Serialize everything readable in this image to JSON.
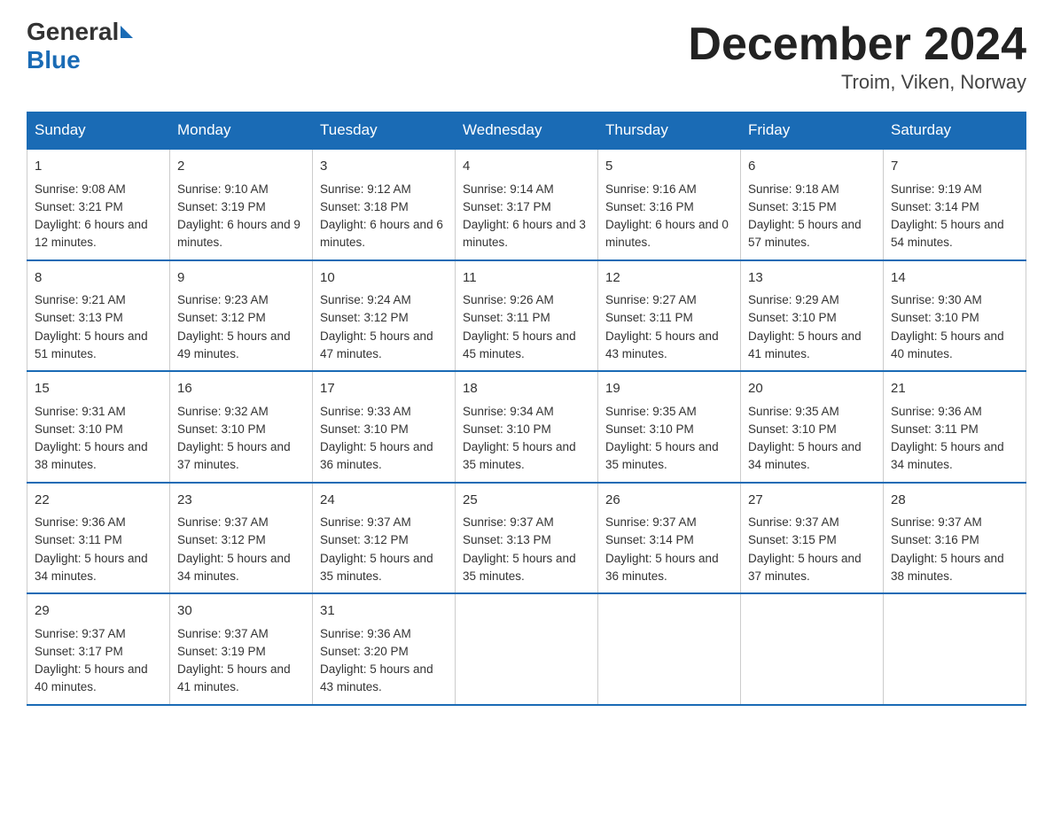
{
  "header": {
    "logo_general": "General",
    "logo_blue": "Blue",
    "month_title": "December 2024",
    "location": "Troim, Viken, Norway"
  },
  "days_of_week": [
    "Sunday",
    "Monday",
    "Tuesday",
    "Wednesday",
    "Thursday",
    "Friday",
    "Saturday"
  ],
  "weeks": [
    [
      {
        "day": "1",
        "sunrise": "Sunrise: 9:08 AM",
        "sunset": "Sunset: 3:21 PM",
        "daylight": "Daylight: 6 hours and 12 minutes."
      },
      {
        "day": "2",
        "sunrise": "Sunrise: 9:10 AM",
        "sunset": "Sunset: 3:19 PM",
        "daylight": "Daylight: 6 hours and 9 minutes."
      },
      {
        "day": "3",
        "sunrise": "Sunrise: 9:12 AM",
        "sunset": "Sunset: 3:18 PM",
        "daylight": "Daylight: 6 hours and 6 minutes."
      },
      {
        "day": "4",
        "sunrise": "Sunrise: 9:14 AM",
        "sunset": "Sunset: 3:17 PM",
        "daylight": "Daylight: 6 hours and 3 minutes."
      },
      {
        "day": "5",
        "sunrise": "Sunrise: 9:16 AM",
        "sunset": "Sunset: 3:16 PM",
        "daylight": "Daylight: 6 hours and 0 minutes."
      },
      {
        "day": "6",
        "sunrise": "Sunrise: 9:18 AM",
        "sunset": "Sunset: 3:15 PM",
        "daylight": "Daylight: 5 hours and 57 minutes."
      },
      {
        "day": "7",
        "sunrise": "Sunrise: 9:19 AM",
        "sunset": "Sunset: 3:14 PM",
        "daylight": "Daylight: 5 hours and 54 minutes."
      }
    ],
    [
      {
        "day": "8",
        "sunrise": "Sunrise: 9:21 AM",
        "sunset": "Sunset: 3:13 PM",
        "daylight": "Daylight: 5 hours and 51 minutes."
      },
      {
        "day": "9",
        "sunrise": "Sunrise: 9:23 AM",
        "sunset": "Sunset: 3:12 PM",
        "daylight": "Daylight: 5 hours and 49 minutes."
      },
      {
        "day": "10",
        "sunrise": "Sunrise: 9:24 AM",
        "sunset": "Sunset: 3:12 PM",
        "daylight": "Daylight: 5 hours and 47 minutes."
      },
      {
        "day": "11",
        "sunrise": "Sunrise: 9:26 AM",
        "sunset": "Sunset: 3:11 PM",
        "daylight": "Daylight: 5 hours and 45 minutes."
      },
      {
        "day": "12",
        "sunrise": "Sunrise: 9:27 AM",
        "sunset": "Sunset: 3:11 PM",
        "daylight": "Daylight: 5 hours and 43 minutes."
      },
      {
        "day": "13",
        "sunrise": "Sunrise: 9:29 AM",
        "sunset": "Sunset: 3:10 PM",
        "daylight": "Daylight: 5 hours and 41 minutes."
      },
      {
        "day": "14",
        "sunrise": "Sunrise: 9:30 AM",
        "sunset": "Sunset: 3:10 PM",
        "daylight": "Daylight: 5 hours and 40 minutes."
      }
    ],
    [
      {
        "day": "15",
        "sunrise": "Sunrise: 9:31 AM",
        "sunset": "Sunset: 3:10 PM",
        "daylight": "Daylight: 5 hours and 38 minutes."
      },
      {
        "day": "16",
        "sunrise": "Sunrise: 9:32 AM",
        "sunset": "Sunset: 3:10 PM",
        "daylight": "Daylight: 5 hours and 37 minutes."
      },
      {
        "day": "17",
        "sunrise": "Sunrise: 9:33 AM",
        "sunset": "Sunset: 3:10 PM",
        "daylight": "Daylight: 5 hours and 36 minutes."
      },
      {
        "day": "18",
        "sunrise": "Sunrise: 9:34 AM",
        "sunset": "Sunset: 3:10 PM",
        "daylight": "Daylight: 5 hours and 35 minutes."
      },
      {
        "day": "19",
        "sunrise": "Sunrise: 9:35 AM",
        "sunset": "Sunset: 3:10 PM",
        "daylight": "Daylight: 5 hours and 35 minutes."
      },
      {
        "day": "20",
        "sunrise": "Sunrise: 9:35 AM",
        "sunset": "Sunset: 3:10 PM",
        "daylight": "Daylight: 5 hours and 34 minutes."
      },
      {
        "day": "21",
        "sunrise": "Sunrise: 9:36 AM",
        "sunset": "Sunset: 3:11 PM",
        "daylight": "Daylight: 5 hours and 34 minutes."
      }
    ],
    [
      {
        "day": "22",
        "sunrise": "Sunrise: 9:36 AM",
        "sunset": "Sunset: 3:11 PM",
        "daylight": "Daylight: 5 hours and 34 minutes."
      },
      {
        "day": "23",
        "sunrise": "Sunrise: 9:37 AM",
        "sunset": "Sunset: 3:12 PM",
        "daylight": "Daylight: 5 hours and 34 minutes."
      },
      {
        "day": "24",
        "sunrise": "Sunrise: 9:37 AM",
        "sunset": "Sunset: 3:12 PM",
        "daylight": "Daylight: 5 hours and 35 minutes."
      },
      {
        "day": "25",
        "sunrise": "Sunrise: 9:37 AM",
        "sunset": "Sunset: 3:13 PM",
        "daylight": "Daylight: 5 hours and 35 minutes."
      },
      {
        "day": "26",
        "sunrise": "Sunrise: 9:37 AM",
        "sunset": "Sunset: 3:14 PM",
        "daylight": "Daylight: 5 hours and 36 minutes."
      },
      {
        "day": "27",
        "sunrise": "Sunrise: 9:37 AM",
        "sunset": "Sunset: 3:15 PM",
        "daylight": "Daylight: 5 hours and 37 minutes."
      },
      {
        "day": "28",
        "sunrise": "Sunrise: 9:37 AM",
        "sunset": "Sunset: 3:16 PM",
        "daylight": "Daylight: 5 hours and 38 minutes."
      }
    ],
    [
      {
        "day": "29",
        "sunrise": "Sunrise: 9:37 AM",
        "sunset": "Sunset: 3:17 PM",
        "daylight": "Daylight: 5 hours and 40 minutes."
      },
      {
        "day": "30",
        "sunrise": "Sunrise: 9:37 AM",
        "sunset": "Sunset: 3:19 PM",
        "daylight": "Daylight: 5 hours and 41 minutes."
      },
      {
        "day": "31",
        "sunrise": "Sunrise: 9:36 AM",
        "sunset": "Sunset: 3:20 PM",
        "daylight": "Daylight: 5 hours and 43 minutes."
      },
      null,
      null,
      null,
      null
    ]
  ]
}
